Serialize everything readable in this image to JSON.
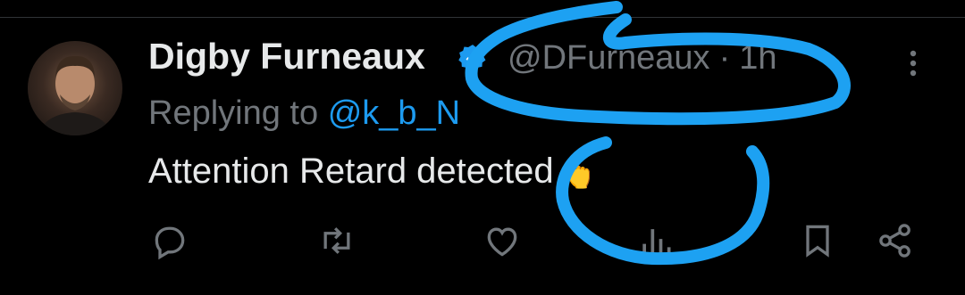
{
  "tweet": {
    "author_name": "Digby Furneaux",
    "handle": "@DFurneaux",
    "separator": "·",
    "timestamp": "1h",
    "replying_prefix": "Replying to",
    "replying_to": "@k_b_N",
    "text": "Attention Retard detected",
    "emoji": "👆"
  },
  "icons": {
    "verified": "verified-badge-icon",
    "more": "more-icon",
    "reply": "reply-icon",
    "retweet": "retweet-icon",
    "like": "like-icon",
    "views": "views-icon",
    "bookmark": "bookmark-icon",
    "share": "share-icon"
  },
  "colors": {
    "background": "#000000",
    "primary_text": "#e7e9ea",
    "secondary_text": "#71767b",
    "accent": "#1d9bf0",
    "annotation": "#1da1f2"
  }
}
